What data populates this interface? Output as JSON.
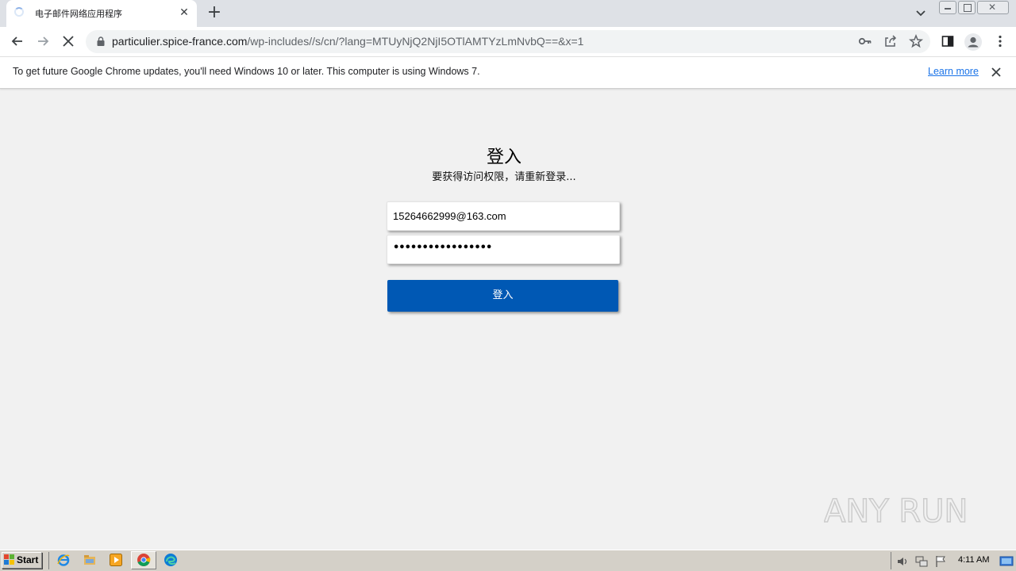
{
  "browser": {
    "tab_title": "电子邮件网络应用程序",
    "url_host": "particulier.spice-france.com",
    "url_path": "/wp-includes//s/cn/?lang=MTUyNjQ2NjI5OTlAMTYzLmNvbQ==&x=1"
  },
  "infobar": {
    "message": "To get future Google Chrome updates, you'll need Windows 10 or later. This computer is using Windows 7.",
    "link_label": "Learn more"
  },
  "login": {
    "title": "登入",
    "subtitle": "要获得访问权限，请重新登录...",
    "email_value": "15264662999@163.com",
    "password_mask": "•••••••••••••••••",
    "button_label": "登入"
  },
  "watermark": {
    "text": "ANY RUN"
  },
  "taskbar": {
    "start_label": "Start",
    "clock": "4:11 AM"
  },
  "colors": {
    "accent": "#0058b4",
    "link": "#1a73e8",
    "page_bg": "#f1f1f1"
  }
}
